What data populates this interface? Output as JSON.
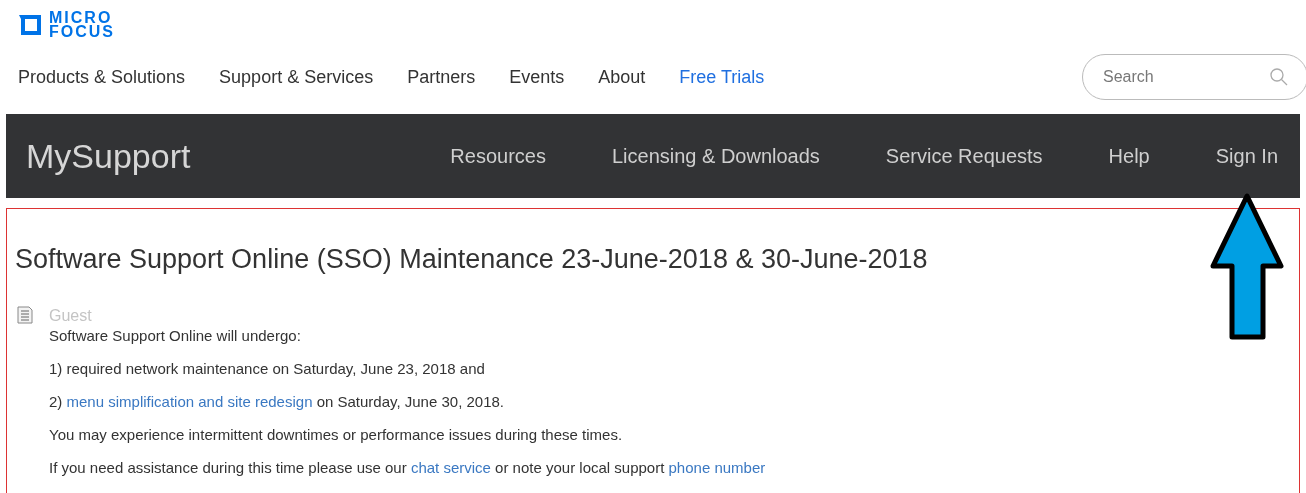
{
  "logo": {
    "line_1": "MICRO",
    "line_2": "FOCUS"
  },
  "nav": [
    {
      "label": "Products & Solutions",
      "highlighted": false
    },
    {
      "label": "Support & Services",
      "highlighted": false
    },
    {
      "label": "Partners",
      "highlighted": false
    },
    {
      "label": "Events",
      "highlighted": false
    },
    {
      "label": "About",
      "highlighted": false
    },
    {
      "label": "Free Trials",
      "highlighted": true
    }
  ],
  "search": {
    "placeholder": "Search"
  },
  "support_bar": {
    "title": "MySupport",
    "items": [
      "Resources",
      "Licensing & Downloads",
      "Service Requests",
      "Help",
      "Sign In"
    ]
  },
  "article": {
    "title": "Software Support Online (SSO) Maintenance 23-June-2018 & 30-June-2018",
    "author": "Guest",
    "paragraphs": [
      [
        {
          "kind": "text",
          "text": "Software Support Online will undergo:"
        }
      ],
      [
        {
          "kind": "text",
          "text": "1) required network maintenance on Saturday, June 23, 2018 and"
        }
      ],
      [
        {
          "kind": "text",
          "text": "2) "
        },
        {
          "kind": "link",
          "text": "menu simplification and site redesign"
        },
        {
          "kind": "text",
          "text": " on Saturday, June 30, 2018."
        }
      ],
      [
        {
          "kind": "text",
          "text": "You may experience intermittent downtimes or performance issues during these times."
        }
      ],
      [
        {
          "kind": "text",
          "text": "If you need assistance during this time please use our "
        },
        {
          "kind": "link",
          "text": "chat service"
        },
        {
          "kind": "text",
          "text": " or note your local support "
        },
        {
          "kind": "link",
          "text": "phone number"
        }
      ]
    ]
  }
}
